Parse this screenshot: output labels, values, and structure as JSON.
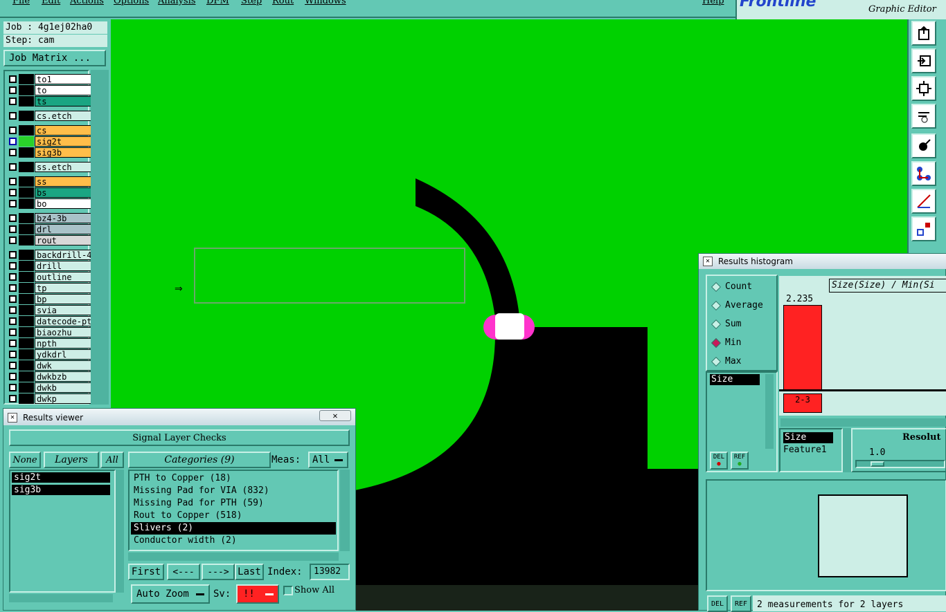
{
  "menu": {
    "items": [
      "File",
      "Edit",
      "Actions",
      "Options",
      "Analysis",
      "DFM",
      "Step",
      "Rout",
      "Windows"
    ],
    "help": "Help"
  },
  "brand": {
    "logo": "Frontline",
    "subtitle": "Graphic Editor"
  },
  "job": {
    "job_label": "Job : 4g1ej02ha0",
    "step_label": "Step: cam",
    "matrix_button": "Job Matrix ..."
  },
  "layers": [
    {
      "name": "to1",
      "color": "#ffffff",
      "swatch": "#000000"
    },
    {
      "name": "to",
      "color": "#ffffff",
      "swatch": "#000000"
    },
    {
      "name": "ts",
      "color": "#1aa582",
      "swatch": "#000000"
    },
    {
      "name": "cs.etch",
      "color": "#cdeee6",
      "swatch": "#000000"
    },
    {
      "name": "cs",
      "color": "#ffbe4a",
      "swatch": "#000000"
    },
    {
      "name": "sig2t",
      "color": "#ffbe4a",
      "swatch": "#2ad12a"
    },
    {
      "name": "sig3b",
      "color": "#ffbe4a",
      "swatch": "#000000"
    },
    {
      "name": "ss.etch",
      "color": "#cdeee6",
      "swatch": "#000000"
    },
    {
      "name": "ss",
      "color": "#ffbe4a",
      "swatch": "#000000"
    },
    {
      "name": "bs",
      "color": "#1aa582",
      "swatch": "#000000"
    },
    {
      "name": "bo",
      "color": "#ffffff",
      "swatch": "#000000"
    },
    {
      "name": "bz4-3b",
      "color": "#a9c2c8",
      "swatch": "#000000"
    },
    {
      "name": "drl",
      "color": "#a9c2c8",
      "swatch": "#000000"
    },
    {
      "name": "rout",
      "color": "#d8d8d8",
      "swatch": "#000000"
    },
    {
      "name": "backdrill-4",
      "color": "#cdeee6",
      "swatch": "#000000"
    },
    {
      "name": "drill",
      "color": "#cdeee6",
      "swatch": "#000000"
    },
    {
      "name": "outline",
      "color": "#cdeee6",
      "swatch": "#000000"
    },
    {
      "name": "tp",
      "color": "#cdeee6",
      "swatch": "#000000"
    },
    {
      "name": "bp",
      "color": "#cdeee6",
      "swatch": "#000000"
    },
    {
      "name": "svia",
      "color": "#cdeee6",
      "swatch": "#000000"
    },
    {
      "name": "datecode-pto",
      "color": "#cdeee6",
      "swatch": "#000000"
    },
    {
      "name": "biaozhu",
      "color": "#cdeee6",
      "swatch": "#000000"
    },
    {
      "name": "npth",
      "color": "#cdeee6",
      "swatch": "#000000"
    },
    {
      "name": "ydkdrl",
      "color": "#cdeee6",
      "swatch": "#000000"
    },
    {
      "name": "dwk",
      "color": "#cdeee6",
      "swatch": "#000000"
    },
    {
      "name": "dwkbzb",
      "color": "#cdeee6",
      "swatch": "#000000"
    },
    {
      "name": "dwkb",
      "color": "#cdeee6",
      "swatch": "#000000"
    },
    {
      "name": "dwkp",
      "color": "#cdeee6",
      "swatch": "#000000"
    }
  ],
  "results_viewer": {
    "title": "Results viewer",
    "header": "Signal Layer Checks",
    "none_btn": "None",
    "layers_btn": "Layers",
    "all_btn": "All",
    "layers": [
      "sig2t",
      "sig3b"
    ],
    "categories_btn": "Categories (9)",
    "meas_label": "Meas:",
    "meas_value": "All",
    "categories": [
      "PTH to Copper (18)",
      "Missing Pad for VIA (832)",
      "Missing Pad for PTH (59)",
      "Rout to Copper (518)",
      "Slivers (2)",
      "Conductor width (2)"
    ],
    "selected_category": "Slivers (2)",
    "first_btn": "First",
    "prev_btn": "<---",
    "next_btn": "--->",
    "last_btn": "Last",
    "index_label": "Index:",
    "index_value": "13982",
    "zoom_value": "Auto Zoom",
    "sv_label": "Sv:",
    "sv_value": "!!",
    "show_all": "Show All"
  },
  "histogram": {
    "title": "Results histogram",
    "modes": [
      "Count",
      "Average",
      "Sum",
      "Min",
      "Max"
    ],
    "selected_mode": "Min",
    "attr_list": [
      "Size"
    ],
    "chart_title": "Size(Size) / Min(Si",
    "bar_value": "2.235",
    "bar_label": "2-3",
    "list2": [
      "Size",
      "Feature1"
    ],
    "resolution_label": "Resolut",
    "resolution_value": "1.0",
    "del_label": "DEL",
    "ref_label": "REF",
    "status": "2 measurements for 2 layers"
  },
  "colors": {
    "board": "#00d100",
    "bg": "#63c8b4",
    "accent": "#ff2222",
    "highlight": "#ff33cc"
  }
}
